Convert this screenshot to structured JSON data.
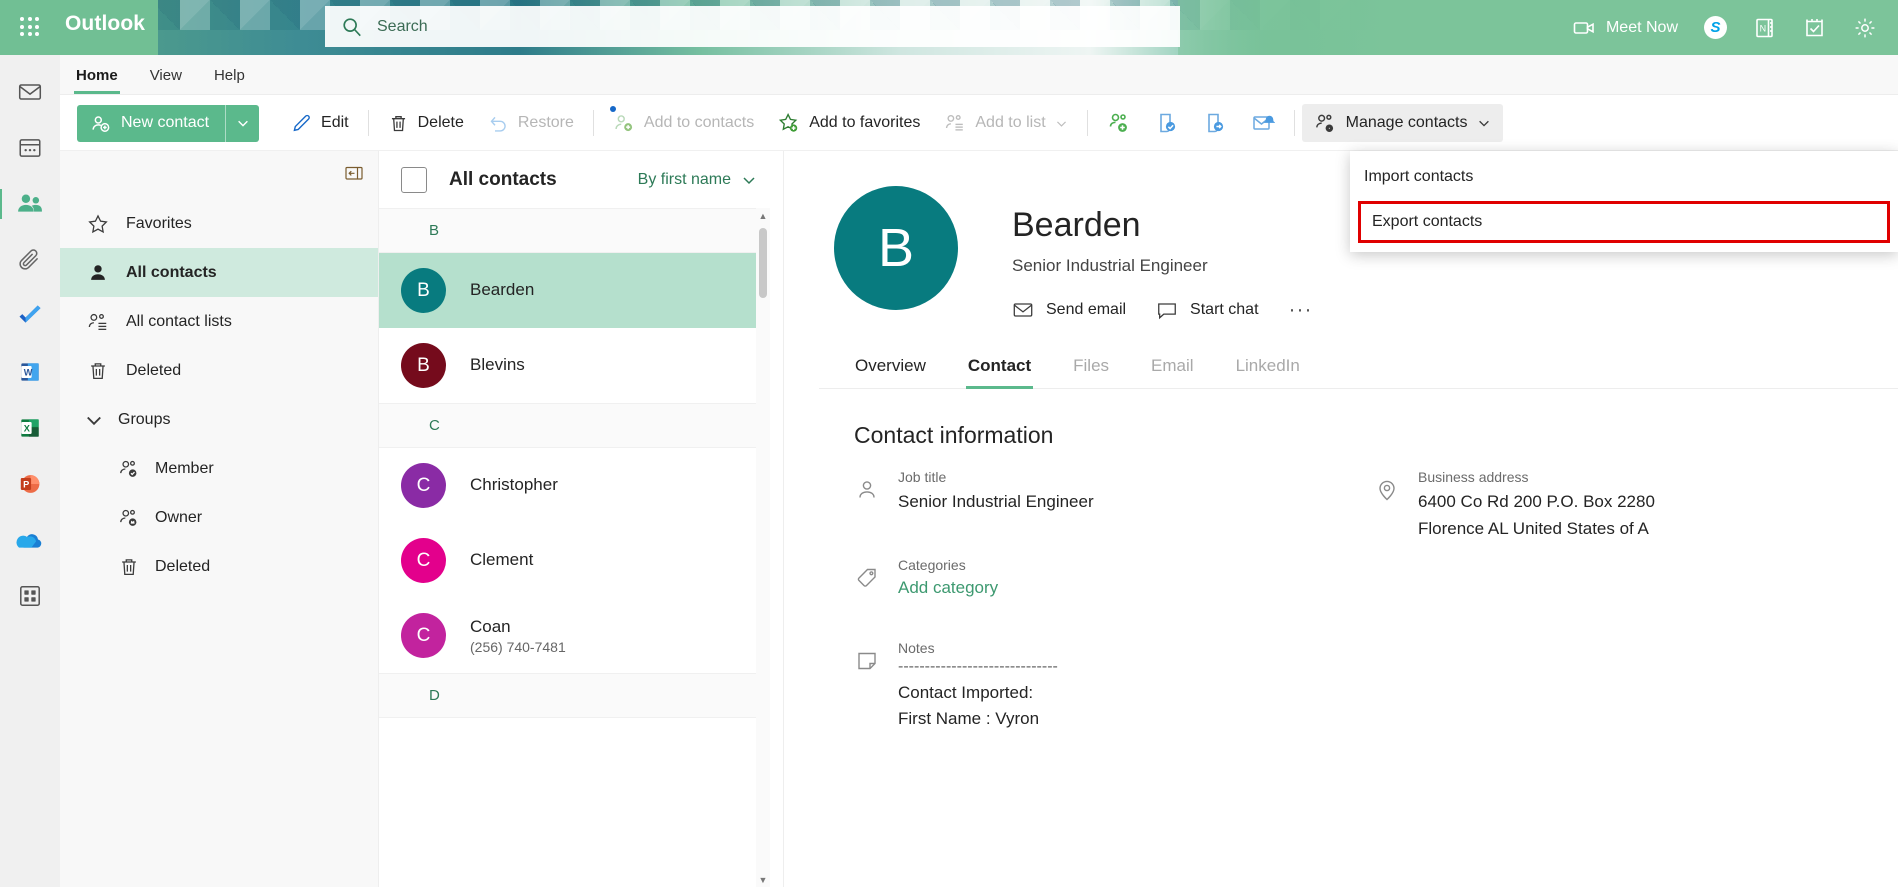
{
  "header": {
    "brand": "Outlook",
    "waffle_icon": "app-launcher-icon",
    "search": {
      "placeholder": "Search",
      "value": "",
      "icon": "search-icon"
    },
    "actions": [
      {
        "label": "Meet Now",
        "icon": "video-camera-icon"
      },
      {
        "label": "S",
        "icon": "skype-icon"
      },
      {
        "label": "",
        "icon": "onenote-icon"
      },
      {
        "label": "",
        "icon": "tasks-calendar-icon"
      },
      {
        "label": "",
        "icon": "gear-icon"
      }
    ]
  },
  "ribbon": {
    "tabs": [
      {
        "label": "Home",
        "active": true
      },
      {
        "label": "View",
        "active": false
      },
      {
        "label": "Help",
        "active": false
      }
    ]
  },
  "commandbar": {
    "new_contact": {
      "label": "New contact",
      "icon": "add-person-icon",
      "caret": "chevron-down-icon"
    },
    "commands": [
      {
        "label": "Edit",
        "icon": "pencil-icon",
        "disabled": false
      },
      {
        "label": "Delete",
        "icon": "trash-icon",
        "disabled": false
      },
      {
        "label": "Restore",
        "icon": "undo-arrow-icon",
        "disabled": true
      },
      {
        "label": "Add to contacts",
        "icon": "add-to-contacts-icon",
        "disabled": true
      },
      {
        "label": "Add to favorites",
        "icon": "star-add-icon",
        "disabled": false
      },
      {
        "label": "Add to list",
        "icon": "add-to-list-icon",
        "disabled": true,
        "caret": "chevron-down-icon"
      }
    ],
    "icon_only": [
      {
        "icon": "add-contact-green-icon"
      },
      {
        "icon": "share-contact-icon"
      },
      {
        "icon": "forward-contact-icon"
      },
      {
        "icon": "mail-alert-icon"
      }
    ],
    "manage_contacts": {
      "label": "Manage contacts",
      "icon": "manage-contacts-icon",
      "caret": "chevron-down-icon",
      "expanded": true
    }
  },
  "dropdown": {
    "items": [
      {
        "label": "Import contacts",
        "highlighted": false
      },
      {
        "label": "Export contacts",
        "highlighted": true
      }
    ],
    "highlight_color": "#e00000"
  },
  "rail": {
    "items": [
      {
        "name": "mail",
        "icon": "mail-icon",
        "active": false
      },
      {
        "name": "calendar",
        "icon": "calendar-icon",
        "active": false
      },
      {
        "name": "people",
        "icon": "people-icon",
        "active": true
      },
      {
        "name": "files",
        "icon": "paperclip-icon",
        "active": false
      },
      {
        "name": "todo",
        "icon": "todo-check-icon",
        "active": false
      },
      {
        "name": "word",
        "icon": "word-icon",
        "active": false
      },
      {
        "name": "excel",
        "icon": "excel-icon",
        "active": false
      },
      {
        "name": "powerpoint",
        "icon": "powerpoint-icon",
        "active": false
      },
      {
        "name": "onedrive",
        "icon": "onedrive-icon",
        "active": false
      },
      {
        "name": "all-apps",
        "icon": "apps-grid-icon",
        "active": false
      }
    ]
  },
  "sidebar": {
    "collapse_icon": "collapse-pane-icon",
    "items": [
      {
        "label": "Favorites",
        "icon": "star-icon",
        "selected": false,
        "nested": false
      },
      {
        "label": "All contacts",
        "icon": "person-filled-icon",
        "selected": true,
        "nested": false
      },
      {
        "label": "All contact lists",
        "icon": "contact-list-icon",
        "selected": false,
        "nested": false
      },
      {
        "label": "Deleted",
        "icon": "trash-icon",
        "selected": false,
        "nested": false
      }
    ],
    "groups_header": {
      "label": "Groups",
      "icon": "chevron-down-icon",
      "expanded": true
    },
    "group_items": [
      {
        "label": "Member",
        "icon": "member-group-icon"
      },
      {
        "label": "Owner",
        "icon": "owner-group-icon"
      },
      {
        "label": "Deleted",
        "icon": "trash-icon"
      }
    ]
  },
  "list": {
    "title": "All contacts",
    "select_all_checked": false,
    "sort": {
      "label": "By first name",
      "caret": "chevron-down-icon"
    },
    "sections": [
      {
        "letter": "B",
        "contacts": [
          {
            "name": "Bearden",
            "initial": "B",
            "color": "#087b7f",
            "sub": "",
            "selected": true
          },
          {
            "name": "Blevins",
            "initial": "B",
            "color": "#750b1c",
            "sub": "",
            "selected": false
          }
        ]
      },
      {
        "letter": "C",
        "contacts": [
          {
            "name": "Christopher",
            "initial": "C",
            "color": "#8a2ba5",
            "sub": "",
            "selected": false
          },
          {
            "name": "Clement",
            "initial": "C",
            "color": "#e3008c",
            "sub": "",
            "selected": false
          },
          {
            "name": "Coan",
            "initial": "C",
            "color": "#c2239e",
            "sub": "(256) 740-7481",
            "selected": false
          }
        ]
      },
      {
        "letter": "D",
        "contacts": []
      }
    ]
  },
  "detail": {
    "initial": "B",
    "avatar_color": "#087b7f",
    "name": "Bearden",
    "role": "Senior Industrial Engineer",
    "actions": [
      {
        "label": "Send email",
        "icon": "envelope-icon"
      },
      {
        "label": "Start chat",
        "icon": "chat-bubble-icon"
      }
    ],
    "more_label": "···",
    "tabs": [
      {
        "label": "Overview",
        "active": false,
        "dim": false
      },
      {
        "label": "Contact",
        "active": true,
        "dim": false
      },
      {
        "label": "Files",
        "active": false,
        "dim": true
      },
      {
        "label": "Email",
        "active": false,
        "dim": true
      },
      {
        "label": "LinkedIn",
        "active": false,
        "dim": true
      }
    ],
    "section_title": "Contact information",
    "fields_left": [
      {
        "label": "Job title",
        "value": "Senior Industrial Engineer",
        "icon": "person-outline-icon",
        "type": "text"
      },
      {
        "label": "Categories",
        "value": "Add category",
        "icon": "tag-icon",
        "type": "link"
      },
      {
        "label": "Notes",
        "value": "",
        "icon": "note-icon",
        "type": "notes",
        "rule": "------------------------------",
        "lines": [
          "Contact Imported:",
          "First Name : Vyron"
        ]
      }
    ],
    "fields_right": [
      {
        "label": "Business address",
        "icon": "location-pin-icon",
        "type": "text",
        "lines": [
          "6400 Co Rd 200 P.O. Box 2280",
          "Florence AL United States of A"
        ]
      }
    ]
  }
}
